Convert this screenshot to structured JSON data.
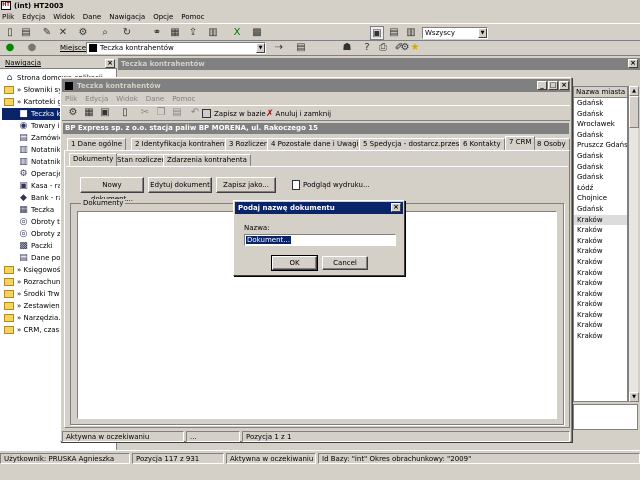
{
  "app": {
    "title": "(int) HT2003",
    "menu": [
      "Plik",
      "Edycja",
      "Widok",
      "Dane",
      "Nawigacja",
      "Opcje",
      "Pomoc"
    ],
    "filter_value": "Wszyscy",
    "location_label": "Miejsce",
    "location_value": "Teczka kontrahentów"
  },
  "nav": {
    "tab": "Nawigacja",
    "items": [
      {
        "label": "Strona domowa aplikacji",
        "level": 0,
        "icon": "home-icon"
      },
      {
        "label": "» Słowniki systemowe",
        "level": 0,
        "icon": "folder-icon"
      },
      {
        "label": "» Kartoteki główne",
        "level": 0,
        "icon": "folder-icon"
      },
      {
        "label": "Teczka kontrahentów",
        "level": 1,
        "icon": "contacts-icon",
        "selected": true
      },
      {
        "label": "Towary i usługi",
        "level": 1,
        "icon": "goods-icon"
      },
      {
        "label": "Zamówienia",
        "level": 1,
        "icon": "order-icon"
      },
      {
        "label": "Notatnik",
        "level": 1,
        "icon": "notebook-icon"
      },
      {
        "label": "Notatnik",
        "level": 1,
        "icon": "notebook-icon"
      },
      {
        "label": "Operacje",
        "level": 1,
        "icon": "operation-icon"
      },
      {
        "label": "Kasa - raporty",
        "level": 1,
        "icon": "cash-icon"
      },
      {
        "label": "Bank - raporty",
        "level": 1,
        "icon": "bank-icon"
      },
      {
        "label": "Teczka",
        "level": 1,
        "icon": "folder-doc-icon"
      },
      {
        "label": "Obroty towarów",
        "level": 1,
        "icon": "turnover-icon"
      },
      {
        "label": "Obroty z kontrahentami",
        "level": 1,
        "icon": "turnover-icon"
      },
      {
        "label": "Paczki",
        "level": 1,
        "icon": "package-icon"
      },
      {
        "label": "Dane pomocnicze",
        "level": 1,
        "icon": "data-icon"
      },
      {
        "label": "» Księgowość",
        "level": 0,
        "icon": "folder-icon"
      },
      {
        "label": "» Rozrachunki",
        "level": 0,
        "icon": "folder-icon"
      },
      {
        "label": "» Środki Trwałe",
        "level": 0,
        "icon": "folder-icon"
      },
      {
        "label": "» Zestawienia",
        "level": 0,
        "icon": "folder-icon"
      },
      {
        "label": "» Narzędzia...",
        "level": 0,
        "icon": "folder-icon"
      },
      {
        "label": "» CRM, czas...",
        "level": 0,
        "icon": "folder-icon"
      }
    ]
  },
  "back_window": {
    "title": "Teczka kontrahentów",
    "column_header": "Nazwa miasta",
    "cities": [
      "Gdańsk",
      "Gdańsk",
      "Wrocławek",
      "Gdańsk",
      "Pruszcz Gdański",
      "Gdańsk",
      "Gdańsk",
      "Gdańsk",
      "Łódź",
      "Chojnice",
      "Gdańsk",
      "Kraków",
      "Kraków",
      "Kraków",
      "Kraków",
      "Kraków",
      "Kraków",
      "Kraków",
      "Kraków",
      "Kraków",
      "Kraków",
      "Kraków",
      "Kraków"
    ]
  },
  "inner_window": {
    "title": "Teczka kontrahentów",
    "menu": [
      "Plik",
      "Edycja",
      "Widok",
      "Dane",
      "Pomoc"
    ],
    "save_label": "Zapisz w bazie",
    "cancel_label": "Anuluj i zamknij",
    "company_header": "BP Express sp. z o.o. stacja paliw BP MORENA, ul. Rakoczego 15",
    "tabs": [
      "1 Dane ogólne",
      "2 Identyfikacja kontrahenta",
      "3 Rozliczenia",
      "4 Pozostałe dane i Uwagi",
      "5 Spedycja - dostarcz.przesyłek",
      "6 Kontakty",
      "7 CRM",
      "8 Osoby"
    ],
    "active_tab_index": 6,
    "subtabs": [
      "Dokumenty",
      "Stan rozliczeń",
      "Zdarzenia kontrahenta"
    ],
    "active_subtab_index": 0,
    "buttons": {
      "new_doc": "Nowy dokument...",
      "edit_doc": "Edytuj dokument",
      "save_as": "Zapisz jako...",
      "preview": "Podgląd wydruku..."
    },
    "documents_group_label": "Dokumenty",
    "status": {
      "left": "Aktywna w oczekiwaniu",
      "middle": "...",
      "right": "Pozycja 1 z 1"
    }
  },
  "dialog": {
    "title": "Podaj nazwę dokumentu",
    "field_label": "Nazwa:",
    "field_value": "Dokument...",
    "ok_label": "OK",
    "cancel_label": "Cancel"
  },
  "statusbar": {
    "user": "Użytkownik: PRUSKA Agnieszka",
    "position": "Pozycja 117 z 931",
    "state": "Aktywna w oczekiwaniu",
    "db": "Id Bazy: \"int\" Okres obrachunkowy: \"2009\""
  }
}
